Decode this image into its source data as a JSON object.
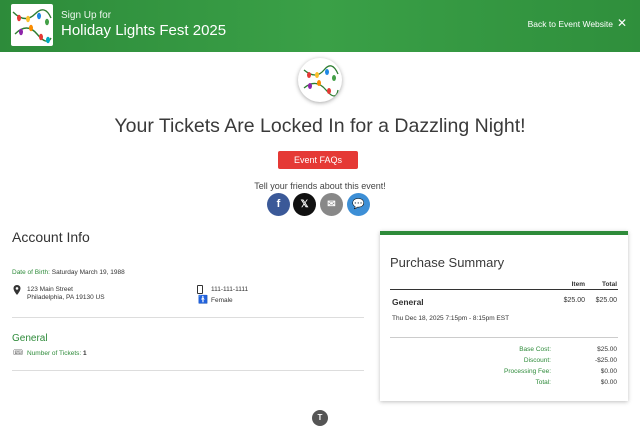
{
  "header": {
    "pre_title": "Sign Up for",
    "title": "Holiday Lights Fest 2025",
    "back_link": "Back to Event Website",
    "close_glyph": "✕"
  },
  "hero": {
    "headline": "Your Tickets Are Locked In for a Dazzling Night!",
    "faq_button": "Event FAQs",
    "share_text": "Tell your friends about this event!",
    "social_icons": [
      "facebook-icon",
      "x-icon",
      "email-icon",
      "chat-icon"
    ],
    "social_glyphs": {
      "facebook": "f",
      "x": "𝕏",
      "email": "✉",
      "chat": "💬"
    }
  },
  "account": {
    "title": "Account Info",
    "dob_label": "Date of Birth:",
    "dob_value": "Saturday March 19, 1988",
    "address_line1": "123 Main Street",
    "address_line2": "Philadelphia, PA 19130 US",
    "phone": "111-111-1111",
    "gender": "Female",
    "ticket_group": "General",
    "tickets_label": "Number of Tickets:",
    "tickets_value": "1"
  },
  "summary": {
    "title": "Purchase Summary",
    "col_item": "Item",
    "col_total": "Total",
    "line_name": "General",
    "line_item": "$25.00",
    "line_total": "$25.00",
    "line_date": "Thu Dec 18, 2025 7:15pm - 8:15pm EST",
    "rows": [
      {
        "label": "Base Cost:",
        "value": "$25.00"
      },
      {
        "label": "Discount:",
        "value": "-$25.00"
      },
      {
        "label": "Processing Fee:",
        "value": "$0.00"
      },
      {
        "label": "Total:",
        "value": "$0.00"
      }
    ]
  },
  "footer": {
    "badge": "T"
  },
  "colors": {
    "brand_green": "#2e8b3a",
    "faq_red": "#e53935",
    "facebook": "#3b5998",
    "chat": "#3d8fd6"
  }
}
